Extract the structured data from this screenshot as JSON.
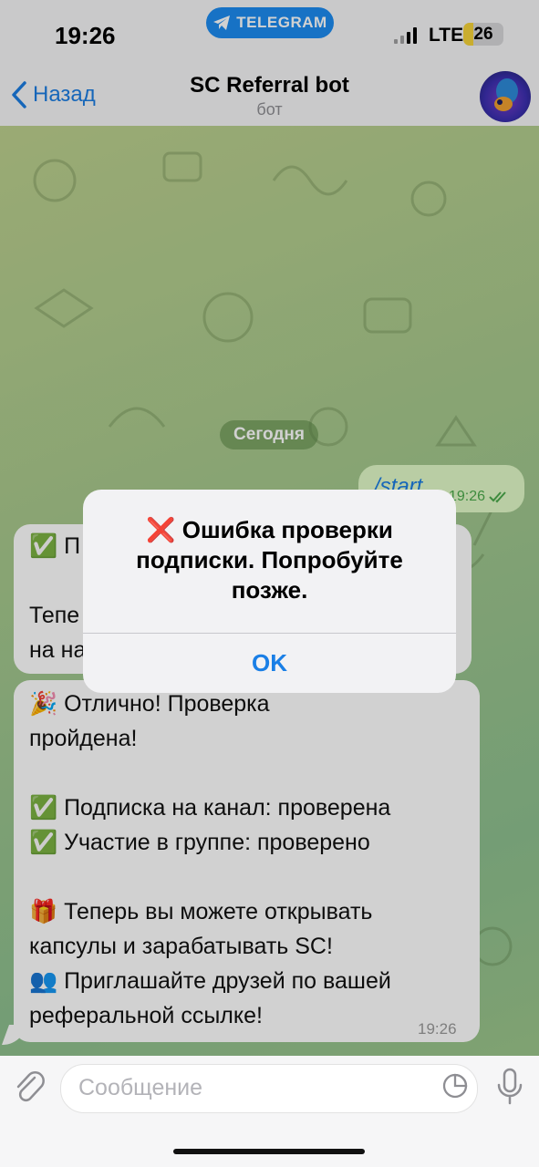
{
  "status_bar": {
    "time": "19:26",
    "network": "LTE",
    "battery": "26",
    "battery_level": 0.26,
    "source_app": "TELEGRAM"
  },
  "header": {
    "back_label": "Назад",
    "title": "SC Referral bot",
    "subtitle": "бот"
  },
  "date_chip": "Сегодня",
  "outgoing": {
    "text": "/start",
    "time": "19:26"
  },
  "messages": [
    {
      "id": "first",
      "text": "✅ П\n\nТепе\nна на"
    },
    {
      "id": "second",
      "text": "🎉 Отлично! Проверка\nпройдена!\n\n✅ Подписка на канал: проверена\n✅ Участие в группе: проверено\n\n🎁 Теперь вы можете открывать\nкапсулы и зарабатывать SC!\n👥 Приглашайте друзей по вашей\nреферальной ссылке!",
      "time": "19:26"
    }
  ],
  "alert": {
    "message": "❌ Ошибка проверки подписки. Попробуйте позже.",
    "ok_label": "OK"
  },
  "input": {
    "placeholder": "Сообщение"
  },
  "colors": {
    "accent": "#1b7de2",
    "outgoing_bubble": "#e2fbc8",
    "check_green": "#4caa4c"
  },
  "icons": [
    "telegram-icon",
    "signal-icon",
    "back-chevron-icon",
    "avatar",
    "double-check-icon",
    "paperclip-icon",
    "sticker-icon",
    "microphone-icon"
  ]
}
